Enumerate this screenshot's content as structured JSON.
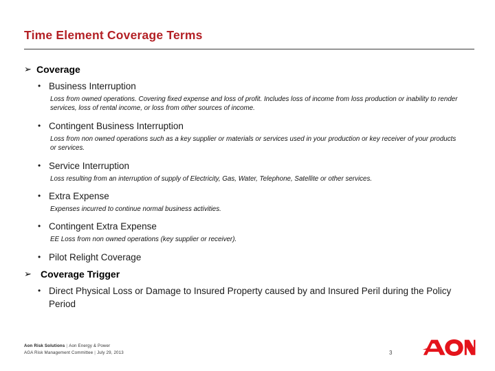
{
  "slide": {
    "title": "Time Element Coverage Terms",
    "title_color": "#b32025",
    "page_number": "3"
  },
  "sections": [
    {
      "bullet_glyph": "➢",
      "heading": "Coverage",
      "items": [
        {
          "bullet_glyph": "•",
          "label": "Business Interruption",
          "note": "Loss from owned operations.  Covering fixed expense and loss of profit. Includes loss of income from loss production or inability to render services, loss of rental income, or loss from other sources of income."
        },
        {
          "bullet_glyph": "•",
          "label": "Contingent Business Interruption",
          "note": "Loss from non owned operations such as a key supplier or materials or services used in your production or key receiver of your products or services."
        },
        {
          "bullet_glyph": "•",
          "label": "Service Interruption",
          "note": "Loss resulting from an interruption of supply of Electricity, Gas, Water, Telephone, Satellite or other services."
        },
        {
          "bullet_glyph": "•",
          "label": "Extra Expense",
          "note": "Expenses incurred to continue normal business activities."
        },
        {
          "bullet_glyph": "•",
          "label": "Contingent Extra Expense",
          "note": "EE Loss from non owned operations (key supplier or receiver)."
        },
        {
          "bullet_glyph": "•",
          "label": "Pilot Relight Coverage",
          "note": ""
        }
      ]
    },
    {
      "bullet_glyph": "➢",
      "heading": "Coverage Trigger",
      "items": [
        {
          "bullet_glyph": "•",
          "label": "Direct Physical Loss or Damage to Insured Property caused by and Insured Peril during the Policy Period",
          "note": ""
        }
      ]
    }
  ],
  "footer": {
    "line1_strong": "Aon Risk Solutions",
    "line1_sep": "|",
    "line1_rest": "Aon Energy & Power",
    "line2_main": "AGA Risk Management Committee",
    "line2_sep": "|",
    "line2_date": "July 29, 2013"
  },
  "logo": {
    "name": "aon-logo",
    "text": "AON",
    "color": "#e4131b"
  }
}
